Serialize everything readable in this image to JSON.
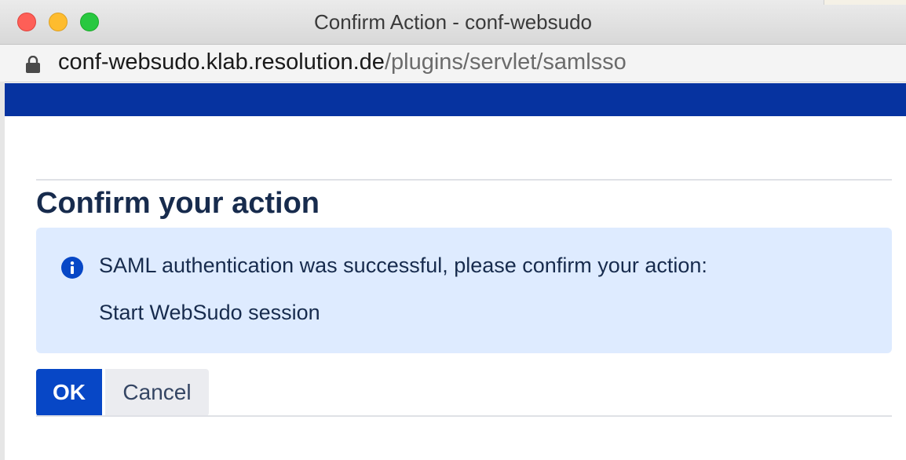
{
  "window": {
    "title": "Confirm Action - conf-websudo"
  },
  "addressbar": {
    "host": "conf-websudo.klab.resolution.de",
    "path": "/plugins/servlet/samlsso",
    "lock_icon": "lock-icon"
  },
  "page": {
    "heading": "Confirm your action",
    "info": {
      "icon": "info-icon",
      "message": "SAML authentication was successful, please confirm your action:",
      "action": "Start WebSudo session"
    },
    "buttons": {
      "ok_label": "OK",
      "cancel_label": "Cancel"
    }
  },
  "colors": {
    "header_band": "#0633a0",
    "info_background": "#deebff",
    "primary_button": "#0747c6",
    "secondary_button": "#ebecf0",
    "text": "#172b4d"
  }
}
